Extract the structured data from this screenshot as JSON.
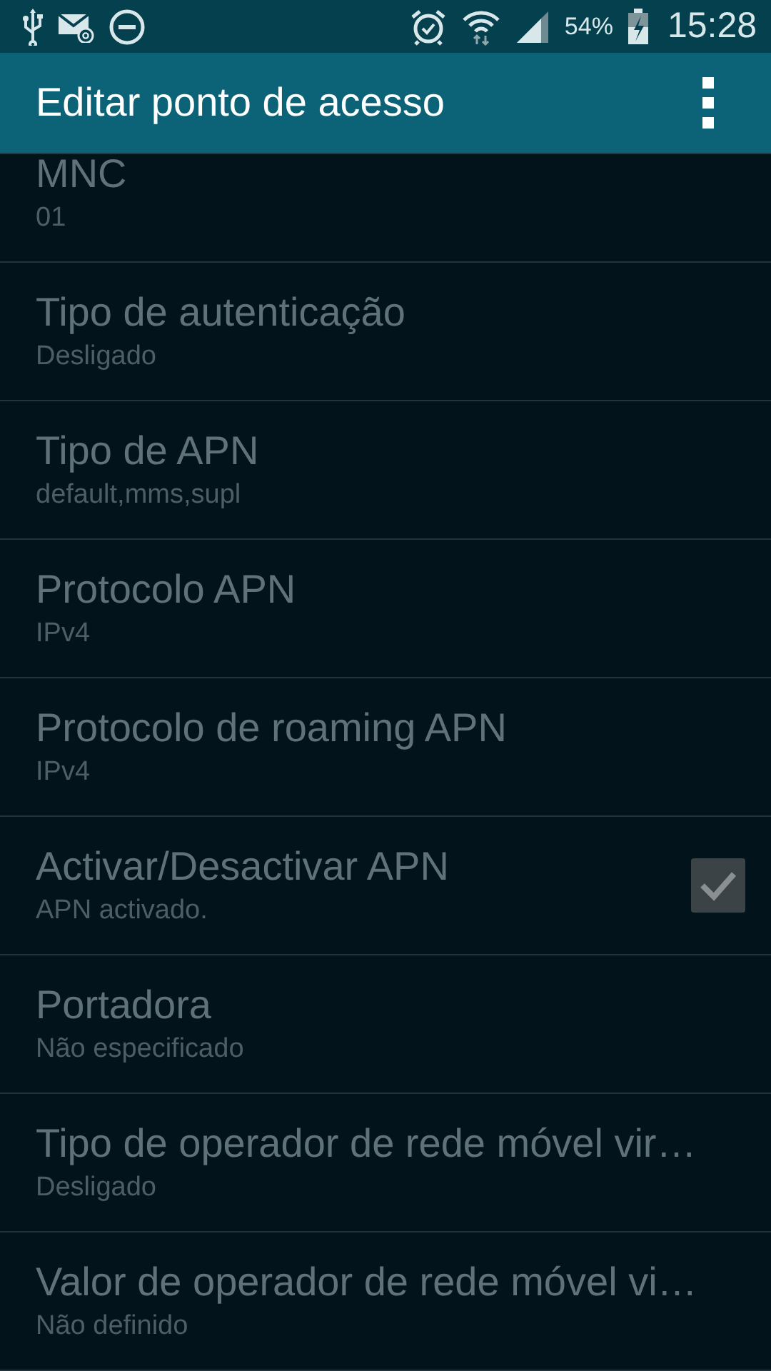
{
  "status_bar": {
    "battery_text": "54%",
    "time": "15:28"
  },
  "app_bar": {
    "title": "Editar ponto de acesso"
  },
  "settings": [
    {
      "kind": "text",
      "title": "MNC",
      "summary": "01",
      "disabled": true
    },
    {
      "kind": "text",
      "title": "Tipo de autenticação",
      "summary": "Desligado",
      "disabled": true
    },
    {
      "kind": "text",
      "title": "Tipo de APN",
      "summary": "default,mms,supl",
      "disabled": true
    },
    {
      "kind": "text",
      "title": "Protocolo APN",
      "summary": "IPv4",
      "disabled": true
    },
    {
      "kind": "text",
      "title": "Protocolo de roaming APN",
      "summary": "IPv4",
      "disabled": true
    },
    {
      "kind": "checkbox",
      "title": "Activar/Desactivar APN",
      "summary": "APN activado.",
      "disabled": true,
      "checked": true
    },
    {
      "kind": "text",
      "title": "Portadora",
      "summary": "Não especificado",
      "disabled": true
    },
    {
      "kind": "text",
      "title": "Tipo de operador de rede móvel vir…",
      "summary": "Desligado",
      "disabled": true
    },
    {
      "kind": "text",
      "title": "Valor de operador de rede móvel vi…",
      "summary": "Não definido",
      "disabled": true
    }
  ]
}
